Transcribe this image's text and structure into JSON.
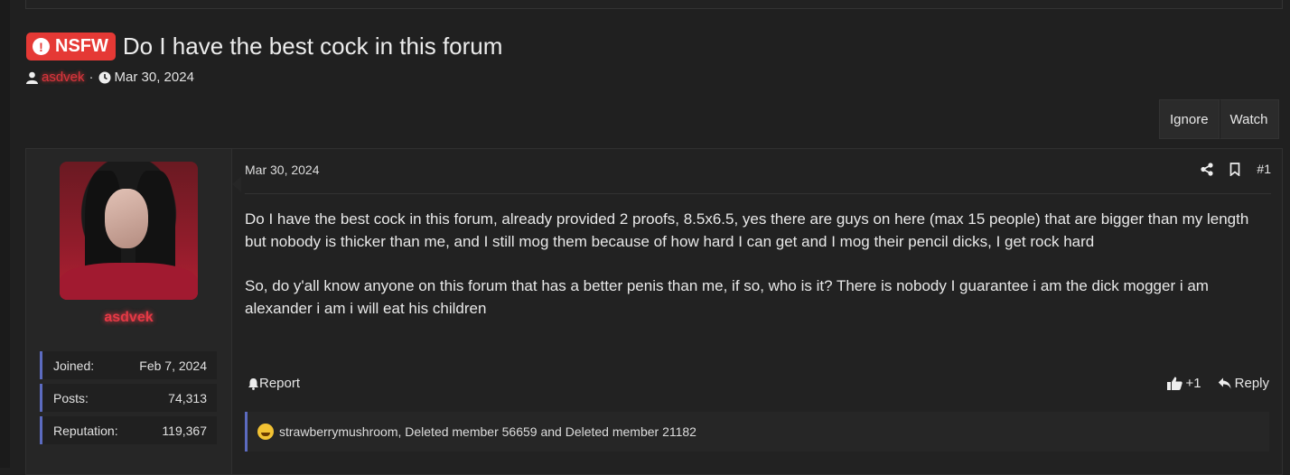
{
  "thread": {
    "badge": "NSFW",
    "title": "Do I have the best cock in this forum",
    "author": "asdvek",
    "separator": "·",
    "date": "Mar 30, 2024"
  },
  "buttons": {
    "ignore": "Ignore",
    "watch": "Watch"
  },
  "user": {
    "name": "asdvek",
    "stats": [
      {
        "label": "Joined:",
        "value": "Feb 7, 2024"
      },
      {
        "label": "Posts:",
        "value": "74,313"
      },
      {
        "label": "Reputation:",
        "value": "119,367"
      }
    ]
  },
  "post": {
    "date": "Mar 30, 2024",
    "number": "#1",
    "paragraphs": [
      "Do I have the best cock in this forum, already provided 2 proofs, 8.5x6.5, yes there are guys on here (max 15 people) that are bigger than my length but nobody is thicker than me, and I still mog them because of how hard I can get and I mog their pencil dicks, I get rock hard",
      "So, do y'all know anyone on this forum that has a better penis than me, if so, who is it? There is nobody I guarantee i am the dick mogger i am alexander i am i will eat his children"
    ],
    "report_label": "Report",
    "like_label": "+1",
    "reply_label": "Reply",
    "reactions_text": "strawberrymushroom, Deleted member 56659 and Deleted member 21182"
  },
  "colors": {
    "accent": "#e53935",
    "stat_border": "#5c6bc0",
    "username": "#e53945"
  },
  "icons": [
    "alert-icon",
    "user-icon",
    "clock-icon",
    "share-icon",
    "bookmark-icon",
    "bell-icon",
    "thumbs-up-icon",
    "reply-icon",
    "crying-laughing-emoji"
  ]
}
